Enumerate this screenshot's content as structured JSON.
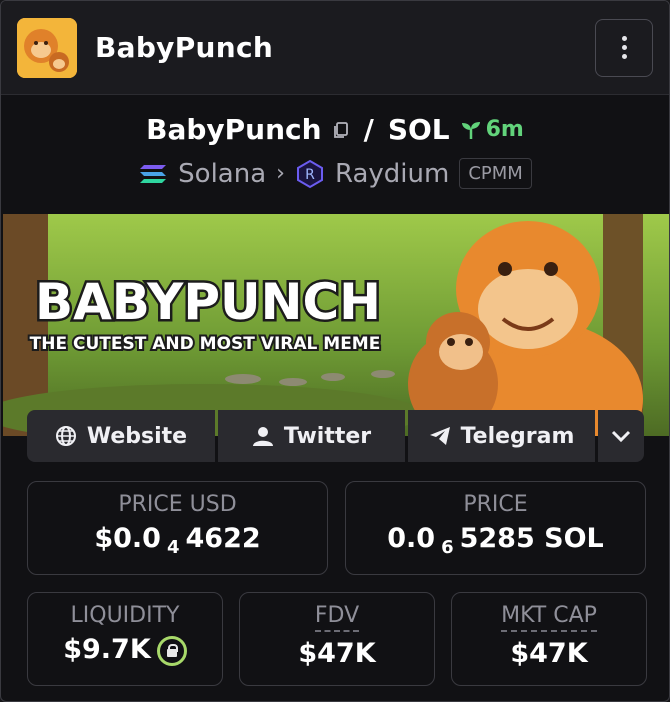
{
  "header": {
    "token_name": "BabyPunch"
  },
  "pair": {
    "base": "BabyPunch",
    "separator": "/",
    "quote": "SOL",
    "age": "6m",
    "chain": "Solana",
    "dex": "Raydium",
    "pool_type": "CPMM"
  },
  "banner": {
    "headline": "BABYPUNCH",
    "tagline": "THE CUTEST AND MOST VIRAL MEME"
  },
  "links": {
    "website": "Website",
    "twitter": "Twitter",
    "telegram": "Telegram"
  },
  "stats": {
    "price_usd_label": "PRICE USD",
    "price_usd_prefix": "$0.0",
    "price_usd_zeros": "4",
    "price_usd_digits": "4622",
    "price_label": "PRICE",
    "price_prefix": "0.0",
    "price_zeros": "6",
    "price_digits": "5285 SOL",
    "liquidity_label": "LIQUIDITY",
    "liquidity_value": "$9.7K",
    "fdv_label": "FDV",
    "fdv_value": "$47K",
    "mktcap_label": "MKT CAP",
    "mktcap_value": "$47K"
  },
  "colors": {
    "age_green": "#62d37b",
    "lock_green": "#a8d96a",
    "banner_orange": "#e8892e"
  }
}
